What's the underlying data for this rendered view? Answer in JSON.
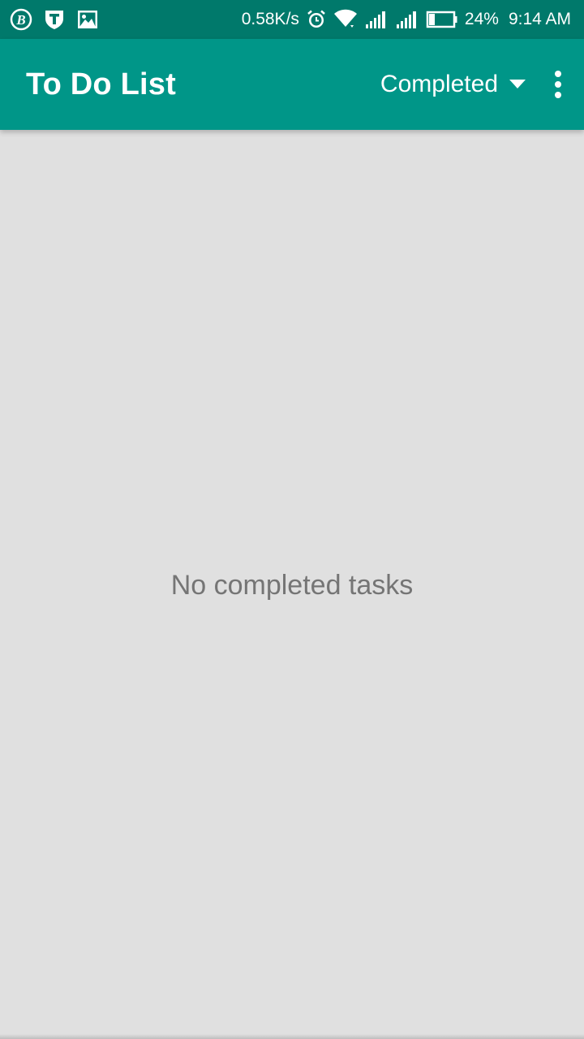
{
  "status_bar": {
    "left_icons": [
      "b-badge-icon",
      "shield-icon",
      "image-icon"
    ],
    "net_speed": "0.58K/s",
    "battery_percent": "24%",
    "time": "9:14 AM",
    "right_icons": [
      "alarm-icon",
      "wifi-icon",
      "signal-icon",
      "signal-icon",
      "battery-icon"
    ],
    "battery_level": 0.24
  },
  "app_bar": {
    "title": "To Do List",
    "filter_selected": "Completed",
    "dropdown_icon": "dropdown-arrow-icon",
    "overflow_icon": "more-vert-icon"
  },
  "content": {
    "empty_message": "No completed tasks"
  },
  "colors": {
    "status_bar": "#00796b",
    "app_bar": "#009688",
    "background": "#e0e0e0",
    "empty_text": "#757575"
  }
}
